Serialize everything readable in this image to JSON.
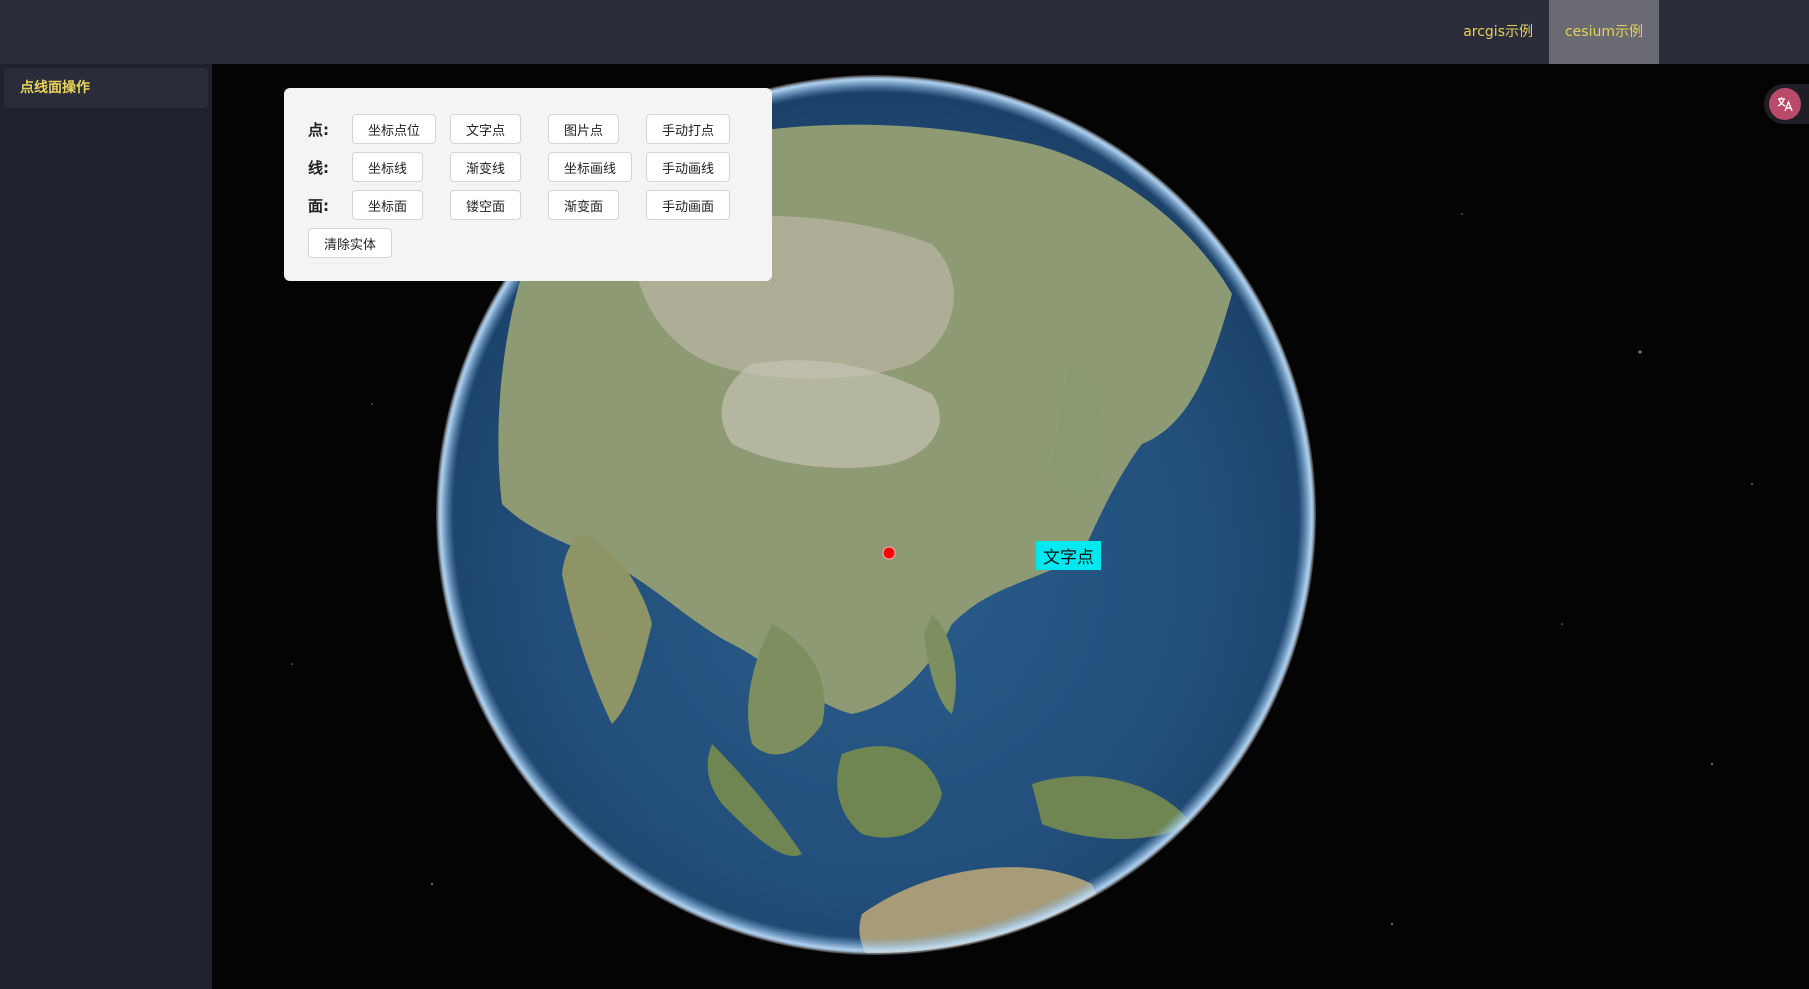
{
  "topnav": {
    "items": [
      {
        "label": "arcgis示例",
        "active": false
      },
      {
        "label": "cesium示例",
        "active": true
      }
    ]
  },
  "sidebar": {
    "items": [
      {
        "label": "点线面操作",
        "active": true
      }
    ]
  },
  "panel": {
    "point_label": "点:",
    "point_buttons": [
      "坐标点位",
      "文字点",
      "图片点",
      "手动打点"
    ],
    "line_label": "线:",
    "line_buttons": [
      "坐标线",
      "渐变线",
      "坐标画线",
      "手动画线"
    ],
    "polygon_label": "面:",
    "polygon_buttons": [
      "坐标面",
      "镂空面",
      "渐变面",
      "手动画面"
    ],
    "clear_button": "清除实体"
  },
  "map": {
    "text_point_label": "文字点",
    "marker_color": "#ff0000",
    "label_background": "#00e9f0"
  },
  "colors": {
    "accent": "#e8d15a",
    "topbar": "#2b2d3b",
    "sidebar": "#20212e"
  },
  "icons": {
    "translate": "translate-icon"
  }
}
